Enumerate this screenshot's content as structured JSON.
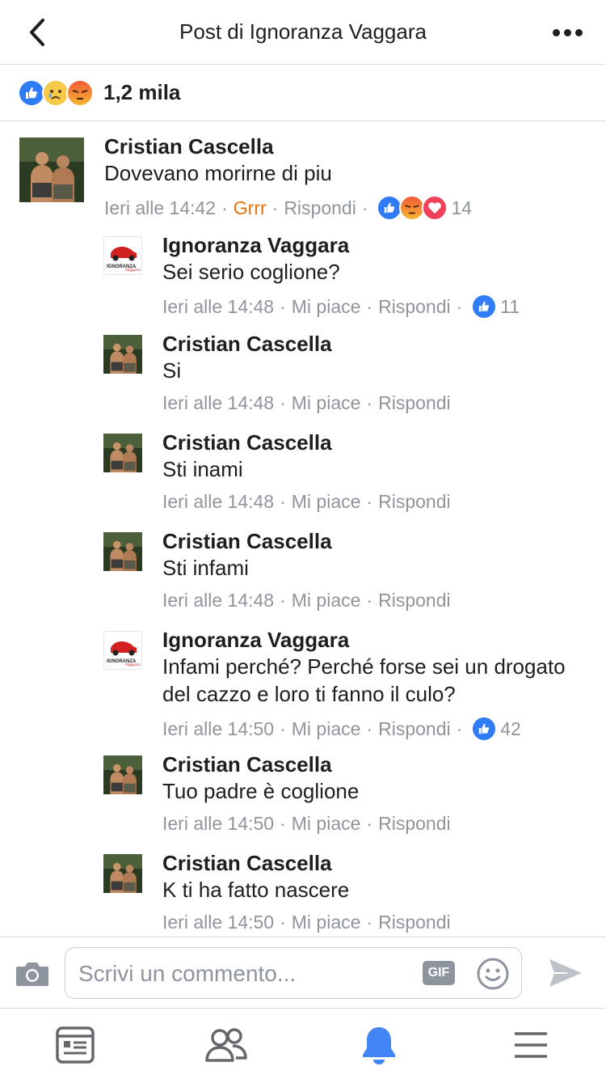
{
  "header": {
    "title": "Post di Ignoranza Vaggara"
  },
  "reactions_summary": {
    "icons": [
      "like",
      "sad",
      "angry"
    ],
    "count": "1,2 mila"
  },
  "comments": [
    {
      "author": "Cristian Cascella",
      "text": "Dovevano morirne di piu",
      "time": "Ieri alle 14:42",
      "action": "Grrr",
      "reply": "Rispondi",
      "reactions": [
        "like",
        "angry",
        "love"
      ],
      "reaction_count": "14",
      "avatar": "person-photo"
    },
    {
      "author": "Ignoranza Vaggara",
      "text": "Sei serio coglione?",
      "time": "Ieri alle 14:48",
      "action": "Mi piace",
      "reply": "Rispondi",
      "reactions": [
        "like"
      ],
      "reaction_count": "11",
      "avatar": "page-logo",
      "logo_text": "IGNORANZA Vaggara"
    },
    {
      "author": "Cristian Cascella",
      "text": "Si",
      "time": "Ieri alle 14:48",
      "action": "Mi piace",
      "reply": "Rispondi",
      "avatar": "person-photo"
    },
    {
      "author": "Cristian Cascella",
      "text": "Sti inami",
      "time": "Ieri alle 14:48",
      "action": "Mi piace",
      "reply": "Rispondi",
      "avatar": "person-photo"
    },
    {
      "author": "Cristian Cascella",
      "text": "Sti infami",
      "time": "Ieri alle 14:48",
      "action": "Mi piace",
      "reply": "Rispondi",
      "avatar": "person-photo"
    },
    {
      "author": "Ignoranza Vaggara",
      "text": "Infami perché? Perché forse sei un drogato del cazzo e loro ti fanno il culo?",
      "time": "Ieri alle 14:50",
      "action": "Mi piace",
      "reply": "Rispondi",
      "reactions": [
        "like"
      ],
      "reaction_count": "42",
      "avatar": "page-logo",
      "logo_text": "IGNORANZA Vaggara"
    },
    {
      "author": "Cristian Cascella",
      "text": "Tuo  padre è coglione",
      "time": "Ieri alle 14:50",
      "action": "Mi piace",
      "reply": "Rispondi",
      "avatar": "person-photo"
    },
    {
      "author": "Cristian Cascella",
      "text": "K ti ha fatto nascere",
      "time": "Ieri alle 14:50",
      "action": "Mi piace",
      "reply": "Rispondi",
      "avatar": "person-photo"
    }
  ],
  "compose": {
    "placeholder": "Scrivi un commento...",
    "gif_label": "GIF"
  },
  "tabbar": {
    "items": [
      "news-feed-icon",
      "friends-icon",
      "notifications-icon",
      "menu-icon"
    ],
    "active": "notifications-icon"
  },
  "colors": {
    "like": "#2f7cf6",
    "love": "#f0405a",
    "grrr": "#e9710f",
    "meta": "#90949c",
    "active_tab": "#4285f4"
  }
}
